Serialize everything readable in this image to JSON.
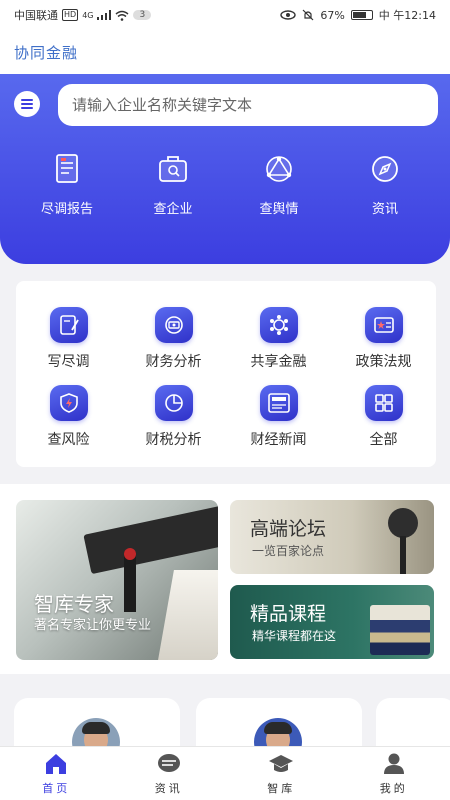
{
  "status_bar": {
    "carrier": "中国联通",
    "hd": "HD",
    "network": "4G",
    "badge": "3",
    "battery": "67%",
    "time": "中 午12:14"
  },
  "app": {
    "title": "协同金融"
  },
  "search": {
    "placeholder": "请输入企业名称关键字文本"
  },
  "hero_nav": [
    {
      "label": "尽调报告",
      "icon": "report-icon"
    },
    {
      "label": "查企业",
      "icon": "briefcase-search-icon"
    },
    {
      "label": "查舆情",
      "icon": "triangle-network-icon"
    },
    {
      "label": "资讯",
      "icon": "compass-icon"
    }
  ],
  "feature_grid": [
    {
      "label": "写尽调",
      "icon": "write-icon"
    },
    {
      "label": "财务分析",
      "icon": "finance-analysis-icon"
    },
    {
      "label": "共享金融",
      "icon": "share-gear-icon"
    },
    {
      "label": "政策法规",
      "icon": "policy-star-icon"
    },
    {
      "label": "查风险",
      "icon": "risk-shield-icon"
    },
    {
      "label": "财税分析",
      "icon": "pie-chart-icon"
    },
    {
      "label": "财经新闻",
      "icon": "news-icon"
    },
    {
      "label": "全部",
      "icon": "grid-icon"
    }
  ],
  "promos": {
    "think_tank": {
      "title": "智库专家",
      "subtitle": "著名专家让你更专业"
    },
    "forum": {
      "title": "高端论坛",
      "subtitle": "一览百家论点"
    },
    "courses": {
      "title": "精品课程",
      "subtitle": "精华课程都在这"
    }
  },
  "tabs": [
    {
      "label": "首页",
      "icon": "home-icon",
      "active": true
    },
    {
      "label": "资讯",
      "icon": "news-bubble-icon",
      "active": false
    },
    {
      "label": "智库",
      "icon": "graduation-cap-icon",
      "active": false
    },
    {
      "label": "我的",
      "icon": "user-icon",
      "active": false
    }
  ],
  "colors": {
    "primary": "#3c3ee0",
    "app_title": "#3f6fc8"
  }
}
